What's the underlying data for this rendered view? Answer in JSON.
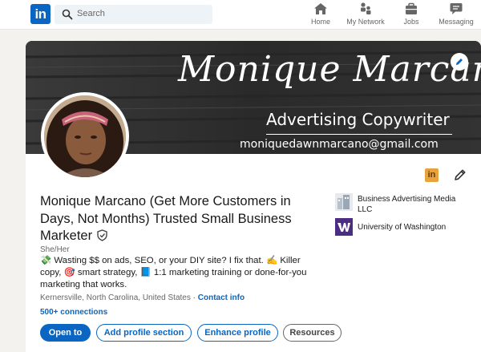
{
  "nav": {
    "logo": "in",
    "search_placeholder": "Search",
    "items": [
      {
        "label": "Home",
        "icon": "home-icon"
      },
      {
        "label": "My Network",
        "icon": "network-icon"
      },
      {
        "label": "Jobs",
        "icon": "briefcase-icon"
      },
      {
        "label": "Messaging",
        "icon": "messaging-icon"
      }
    ]
  },
  "banner": {
    "script_name": "Monique Marcano",
    "role": "Advertising Copywriter",
    "email": "moniquedawnmarcano@gmail.com"
  },
  "profile": {
    "badge": "in",
    "name": "Monique Marcano (Get More Customers in Days, Not Months) Trusted Small Business Marketer",
    "pronouns": "She/Her",
    "headline": "💸 Wasting $$ on ads, SEO, or your DIY site? I fix that. ✍️ Killer copy, 🎯 smart strategy, 📘 1:1 marketing training or done-for-you marketing that works.",
    "location": "Kernersville, North Carolina, United States",
    "separator": " · ",
    "contact_info": "Contact info",
    "connections": "500+ connections"
  },
  "actions": {
    "open_to": "Open to",
    "add_section": "Add profile section",
    "enhance": "Enhance profile",
    "resources": "Resources"
  },
  "right_panel": {
    "company": "Business Advertising Media LLC",
    "education": "University of Washington"
  },
  "colors": {
    "brand_blue": "#0a66c2",
    "uw_purple": "#4b2e83",
    "badge_gold": "#e8a33d"
  }
}
